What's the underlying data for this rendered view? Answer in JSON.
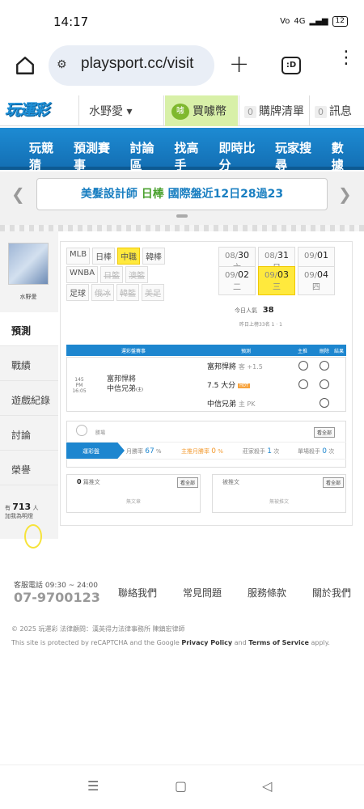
{
  "status": {
    "time": "14:17",
    "battery": "12",
    "signal": "4G"
  },
  "browser": {
    "url": "playsport.cc/visit",
    "tabs_label": ":D"
  },
  "header": {
    "logo": "玩運彩",
    "user": "水野愛 ▾",
    "buy": "買噱幣",
    "coin_label": "噱",
    "cart_count": "0",
    "cart": "購牌清單",
    "msg_count": "0",
    "msg": "訊息"
  },
  "nav": [
    "玩競猜",
    "預測賽事",
    "討論區",
    "找高手",
    "即時比分",
    "玩家搜尋",
    "數據"
  ],
  "banner": {
    "prefix": "美髮設計師",
    "highlight": "日棒",
    "suffix": "國際盤近12日28過23"
  },
  "profile": {
    "name": "水野愛"
  },
  "sidetabs": [
    "預測",
    "戰績",
    "遊戲紀錄",
    "討論",
    "榮譽"
  ],
  "popular": {
    "prefix": "有",
    "count": "713",
    "unit": "人",
    "suffix": "加我為明燈"
  },
  "leagues": {
    "row1": [
      {
        "label": "MLB",
        "state": "normal"
      },
      {
        "label": "日棒",
        "state": "normal"
      },
      {
        "label": "中職",
        "state": "active"
      },
      {
        "label": "韓棒",
        "state": "normal"
      }
    ],
    "row2": [
      {
        "label": "WNBA",
        "state": "normal"
      },
      {
        "label": "日籃",
        "state": "disabled"
      },
      {
        "label": "澳籃",
        "state": "disabled"
      }
    ],
    "row3": [
      {
        "label": "足球",
        "state": "normal"
      },
      {
        "label": "俄冰",
        "state": "disabled"
      },
      {
        "label": "韓籃",
        "state": "disabled"
      },
      {
        "label": "美足",
        "state": "disabled"
      }
    ]
  },
  "dates": {
    "row1": [
      {
        "md": "08/",
        "day": "30",
        "wd": "六"
      },
      {
        "md": "08/",
        "day": "31",
        "wd": "日"
      },
      {
        "md": "09/",
        "day": "01",
        "wd": "一"
      }
    ],
    "row2": [
      {
        "md": "09/",
        "day": "02",
        "wd": "二"
      },
      {
        "md": "09/",
        "day": "03",
        "wd": "三"
      },
      {
        "md": "09/",
        "day": "04",
        "wd": "四"
      }
    ]
  },
  "popularity": {
    "label": "今日人氣",
    "value": "38",
    "ranked": "昨日上榜33名 1 · 1"
  },
  "table": {
    "headers": [
      "運彩盤賽事",
      "預測",
      "主推",
      "刪除",
      "結果"
    ],
    "game_no": "145",
    "game_time": "PM 16:05",
    "home": "富邦悍將",
    "away": "中信兄弟",
    "away_tag": "(主)",
    "picks": [
      {
        "team": "富邦悍將",
        "spread": "客 +1.5"
      },
      {
        "team": "7.5 大分",
        "spread": "HOT"
      },
      {
        "team": "中信兄弟",
        "spread": "主 PK"
      }
    ]
  },
  "stats": {
    "label": "勝場",
    "all": "看全部",
    "tab": "運彩盤",
    "month_lbl": "月勝率",
    "month_val": "67",
    "unit": "%",
    "main_lbl": "主推月勝率",
    "main_val": "0",
    "streak_lbl": "莊家殺手",
    "streak_val": "1",
    "streak_unit": "次",
    "single_lbl": "單場殺手",
    "single_val": "0",
    "single_unit": "次"
  },
  "lists": {
    "left_count": "0",
    "left_label": "篇推文",
    "left_empty": "無文章",
    "right_label": "被推文",
    "right_empty": "無被推文",
    "all": "看全部"
  },
  "footer": {
    "phone_label": "客服電話 09:30 ~ 24:00",
    "phone": "07-9700123",
    "links": [
      "聯絡我們",
      "常見問題",
      "服務條款",
      "關於我們"
    ],
    "copyright": "© 2025 玩運彩 法律顧問：漢英得力法律事務所 陳鎮宏律師",
    "recaptcha_pre": "This site is protected by reCAPTCHA and the Google",
    "privacy": "Privacy Policy",
    "and": "and",
    "terms": "Terms of Service",
    "apply": "apply."
  },
  "system_nav": [
    "☰",
    "▢",
    "◁"
  ]
}
